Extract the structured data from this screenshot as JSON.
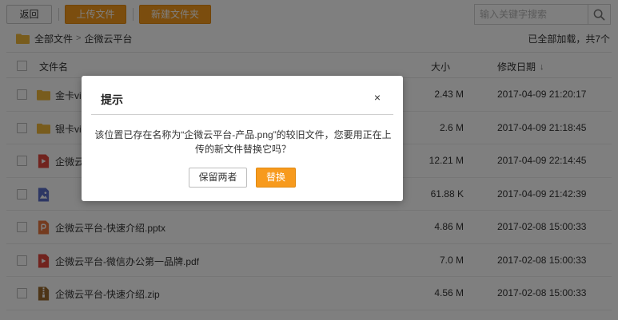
{
  "toolbar": {
    "back_label": "返回",
    "upload_label": "上传文件",
    "new_folder_label": "新建文件夹",
    "search_placeholder": "输入关键字搜索"
  },
  "breadcrumb": {
    "root": "全部文件",
    "current": "企微云平台"
  },
  "load_status": "已全部加载，共7个",
  "table": {
    "headers": {
      "name": "文件名",
      "size": "大小",
      "date": "修改日期"
    },
    "rows": [
      {
        "name": "金卡vip",
        "size": "2.43 M",
        "date": "2017-04-09 21:20:17",
        "icon": "folder-icon"
      },
      {
        "name": "银卡vip",
        "size": "2.6 M",
        "date": "2017-04-09 21:18:45",
        "icon": "folder-icon"
      },
      {
        "name": "企微云",
        "size": "12.21 M",
        "date": "2017-04-09 22:14:45",
        "icon": "video-file-icon"
      },
      {
        "name": "",
        "size": "61.88 K",
        "date": "2017-04-09 21:42:39",
        "icon": "image-file-icon"
      },
      {
        "name": "企微云平台-快速介绍.pptx",
        "size": "4.86 M",
        "date": "2017-02-08 15:00:33",
        "icon": "pptx-file-icon"
      },
      {
        "name": "企微云平台-微信办公第一品牌.pdf",
        "size": "7.0 M",
        "date": "2017-02-08 15:00:33",
        "icon": "pdf-file-icon"
      },
      {
        "name": "企微云平台-快速介绍.zip",
        "size": "4.56 M",
        "date": "2017-02-08 15:00:33",
        "icon": "zip-file-icon"
      }
    ]
  },
  "dialog": {
    "title": "提示",
    "close": "×",
    "message": "该位置已存在名称为“企微云平台-产品.png”的较旧文件，您要用正在上传的新文件替换它吗？",
    "keep_both_label": "保留两者",
    "replace_label": "替换"
  },
  "colors": {
    "accent": "#f79a1d",
    "folder": "#f0b93a",
    "pdf": "#e2463d",
    "image": "#5b6fc9",
    "pptx": "#e9763e",
    "zip": "#9a6a2e"
  }
}
